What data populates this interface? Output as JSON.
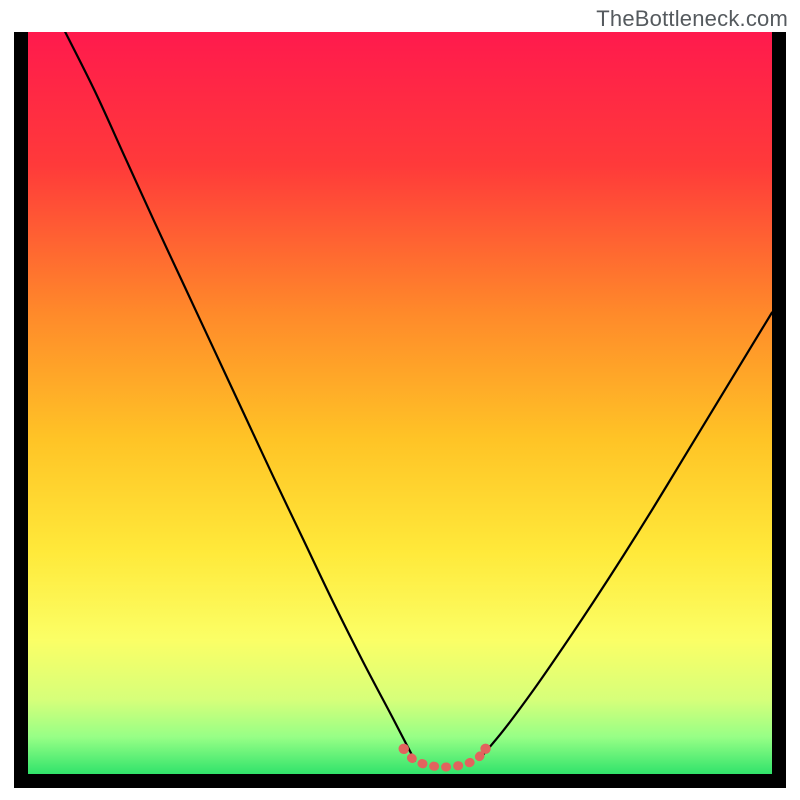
{
  "watermark": "TheBottleneck.com",
  "chart_data": {
    "type": "line",
    "title": "",
    "xlabel": "",
    "ylabel": "",
    "xlim": [
      0,
      1
    ],
    "ylim": [
      0,
      1
    ],
    "gradient_stops": [
      {
        "offset": 0.0,
        "color": "#ff1a4d"
      },
      {
        "offset": 0.18,
        "color": "#ff3a3a"
      },
      {
        "offset": 0.38,
        "color": "#ff8a2a"
      },
      {
        "offset": 0.55,
        "color": "#ffc426"
      },
      {
        "offset": 0.7,
        "color": "#ffe93a"
      },
      {
        "offset": 0.82,
        "color": "#fbff66"
      },
      {
        "offset": 0.9,
        "color": "#d6ff7a"
      },
      {
        "offset": 0.95,
        "color": "#97ff86"
      },
      {
        "offset": 1.0,
        "color": "#31e36b"
      }
    ],
    "series": [
      {
        "name": "left-curve",
        "stroke": "#000000",
        "x": [
          0.05,
          0.09,
          0.13,
          0.17,
          0.21,
          0.25,
          0.29,
          0.33,
          0.37,
          0.41,
          0.45,
          0.49,
          0.52
        ],
        "y": [
          1.0,
          0.92,
          0.832,
          0.744,
          0.658,
          0.572,
          0.486,
          0.4,
          0.316,
          0.232,
          0.152,
          0.076,
          0.018
        ]
      },
      {
        "name": "right-curve",
        "stroke": "#000000",
        "x": [
          0.61,
          0.64,
          0.68,
          0.72,
          0.76,
          0.8,
          0.84,
          0.88,
          0.92,
          0.96,
          1.0
        ],
        "y": [
          0.024,
          0.06,
          0.114,
          0.172,
          0.232,
          0.294,
          0.358,
          0.424,
          0.49,
          0.556,
          0.622
        ]
      },
      {
        "name": "valley-highlight",
        "stroke": "#e2645e",
        "x": [
          0.505,
          0.515,
          0.53,
          0.55,
          0.57,
          0.59,
          0.605,
          0.615
        ],
        "y": [
          0.034,
          0.022,
          0.014,
          0.01,
          0.01,
          0.014,
          0.022,
          0.034
        ]
      }
    ]
  }
}
